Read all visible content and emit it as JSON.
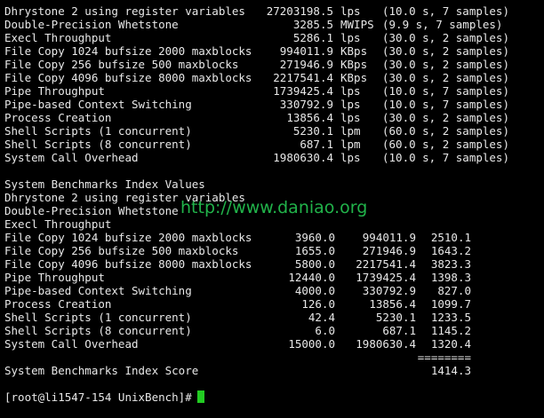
{
  "results": [
    {
      "name": "Dhrystone 2 using register variables",
      "value": "27203198.5",
      "unit": "lps",
      "detail": "(10.0 s, 7 samples)"
    },
    {
      "name": "Double-Precision Whetstone",
      "value": "3285.5",
      "unit": "MWIPS",
      "detail": "(9.9 s, 7 samples)"
    },
    {
      "name": "Execl Throughput",
      "value": "5286.1",
      "unit": "lps",
      "detail": "(30.0 s, 2 samples)"
    },
    {
      "name": "File Copy 1024 bufsize 2000 maxblocks",
      "value": "994011.9",
      "unit": "KBps",
      "detail": "(30.0 s, 2 samples)"
    },
    {
      "name": "File Copy 256 bufsize 500 maxblocks",
      "value": "271946.9",
      "unit": "KBps",
      "detail": "(30.0 s, 2 samples)"
    },
    {
      "name": "File Copy 4096 bufsize 8000 maxblocks",
      "value": "2217541.4",
      "unit": "KBps",
      "detail": "(30.0 s, 2 samples)"
    },
    {
      "name": "Pipe Throughput",
      "value": "1739425.4",
      "unit": "lps",
      "detail": "(10.0 s, 7 samples)"
    },
    {
      "name": "Pipe-based Context Switching",
      "value": "330792.9",
      "unit": "lps",
      "detail": "(10.0 s, 7 samples)"
    },
    {
      "name": "Process Creation",
      "value": "13856.4",
      "unit": "lps",
      "detail": "(30.0 s, 2 samples)"
    },
    {
      "name": "Shell Scripts (1 concurrent)",
      "value": "5230.1",
      "unit": "lpm",
      "detail": "(60.0 s, 2 samples)"
    },
    {
      "name": "Shell Scripts (8 concurrent)",
      "value": "687.1",
      "unit": "lpm",
      "detail": "(60.0 s, 2 samples)"
    },
    {
      "name": "System Call Overhead",
      "value": "1980630.4",
      "unit": "lps",
      "detail": "(10.0 s, 7 samples)"
    }
  ],
  "index_header": "System Benchmarks Index Values",
  "index": [
    {
      "name": "Dhrystone 2 using register variables",
      "baseline": "",
      "result": "",
      "index": ""
    },
    {
      "name": "Double-Precision Whetstone",
      "baseline": "",
      "result": "",
      "index": ""
    },
    {
      "name": "Execl Throughput",
      "baseline": "",
      "result": "",
      "index": ""
    },
    {
      "name": "File Copy 1024 bufsize 2000 maxblocks",
      "baseline": "3960.0",
      "result": "994011.9",
      "index": "2510.1"
    },
    {
      "name": "File Copy 256 bufsize 500 maxblocks",
      "baseline": "1655.0",
      "result": "271946.9",
      "index": "1643.2"
    },
    {
      "name": "File Copy 4096 bufsize 8000 maxblocks",
      "baseline": "5800.0",
      "result": "2217541.4",
      "index": "3823.3"
    },
    {
      "name": "Pipe Throughput",
      "baseline": "12440.0",
      "result": "1739425.4",
      "index": "1398.3"
    },
    {
      "name": "Pipe-based Context Switching",
      "baseline": "4000.0",
      "result": "330792.9",
      "index": "827.0"
    },
    {
      "name": "Process Creation",
      "baseline": "126.0",
      "result": "13856.4",
      "index": "1099.7"
    },
    {
      "name": "Shell Scripts (1 concurrent)",
      "baseline": "42.4",
      "result": "5230.1",
      "index": "1233.5"
    },
    {
      "name": "Shell Scripts (8 concurrent)",
      "baseline": "6.0",
      "result": "687.1",
      "index": "1145.2"
    },
    {
      "name": "System Call Overhead",
      "baseline": "15000.0",
      "result": "1980630.4",
      "index": "1320.4"
    }
  ],
  "separator": "========",
  "score_label": "System Benchmarks Index Score",
  "score_value": "1414.3",
  "prompt": "[root@li1547-154 UnixBench]#",
  "watermark": "http://www.daniao.org",
  "colors": {
    "background": "#000000",
    "text": "#e8e8e8",
    "watermark": "#21b34a",
    "cursor": "#22cc22"
  }
}
